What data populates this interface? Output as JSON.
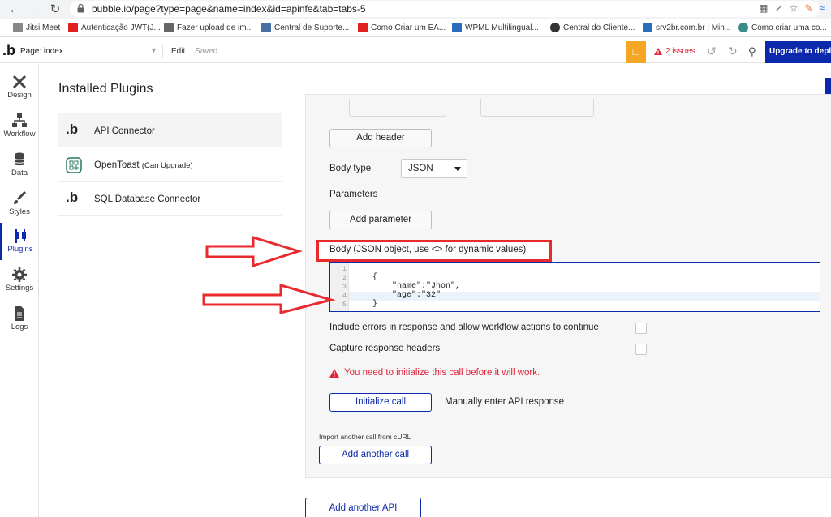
{
  "browser": {
    "url": "bubble.io/page?type=page&name=index&id=apinfe&tab=tabs-5",
    "bookmarks": [
      "Jitsi Meet",
      "Autenticação JWT(J...",
      "Fazer upload de im...",
      "Central de Suporte...",
      "Como Criar um EA...",
      "WPML Multilingual...",
      "Central do Cliente...",
      "srv2br.com.br | Min...",
      "Como criar uma co..."
    ]
  },
  "topbar": {
    "page_label": "Page: index",
    "edit": "Edit",
    "saved": "Saved",
    "issues": "2 issues",
    "upgrade": "Upgrade to deplo"
  },
  "rail": [
    {
      "label": "Design",
      "icon": "design-icon"
    },
    {
      "label": "Workflow",
      "icon": "workflow-icon"
    },
    {
      "label": "Data",
      "icon": "database-icon"
    },
    {
      "label": "Styles",
      "icon": "brush-icon"
    },
    {
      "label": "Plugins",
      "icon": "plug-icon"
    },
    {
      "label": "Settings",
      "icon": "gear-icon"
    },
    {
      "label": "Logs",
      "icon": "document-icon"
    }
  ],
  "plugins": {
    "title": "Installed Plugins",
    "items": [
      {
        "name": "API Connector",
        "note": ""
      },
      {
        "name": "OpenToast",
        "note": "(Can Upgrade)"
      },
      {
        "name": "SQL Database Connector",
        "note": ""
      }
    ]
  },
  "call": {
    "add_header": "Add header",
    "body_type_label": "Body type",
    "body_type_value": "JSON",
    "parameters_label": "Parameters",
    "add_parameter": "Add parameter",
    "body_label": "Body (JSON object, use <> for dynamic values)",
    "code_lines": [
      "",
      "{",
      "    \"name\":\"Jhon\",",
      "    \"age\":\"32\"",
      "}"
    ],
    "line_numbers": [
      "1",
      "2",
      "3",
      "4",
      "5"
    ],
    "include_errors": "Include errors in response and allow workflow actions to continue",
    "capture_headers": "Capture response headers",
    "warning": "You need to initialize this call before it will work.",
    "initialize": "Initialize call",
    "manual": "Manually enter API response"
  },
  "footer": {
    "import_curl": "Import another call from cURL",
    "add_call": "Add another call",
    "add_api": "Add another API"
  },
  "colors": {
    "accent": "#0c29ab",
    "error": "#e0233a",
    "annotation": "#e8292e"
  }
}
